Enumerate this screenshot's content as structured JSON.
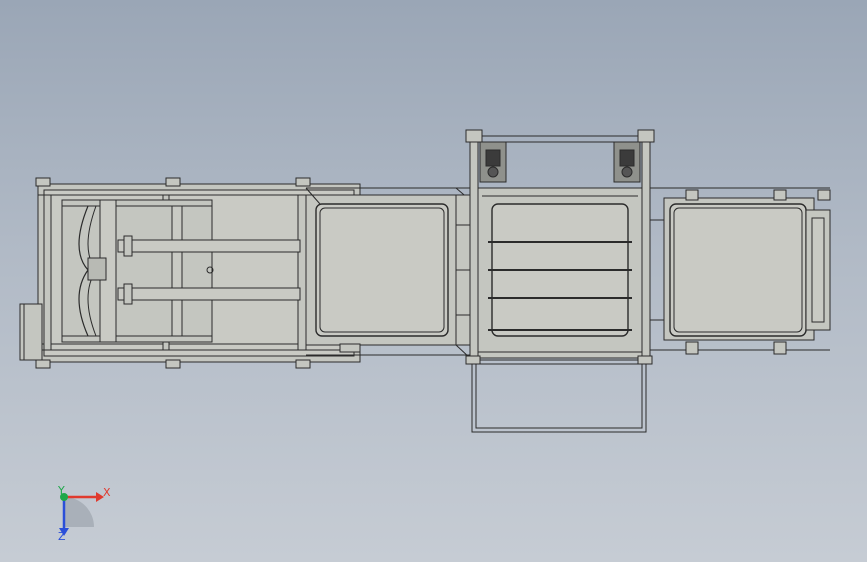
{
  "view": {
    "background_top": "#9aa6b6",
    "background_bottom": "#c6ccd4",
    "model_stroke": "#2b2b2b",
    "model_fill": "#c4c6c0",
    "panel_fill": "#c9cac4"
  },
  "triad": {
    "x_label": "X",
    "y_label": "Y",
    "z_label": "Z",
    "x_color": "#e03a2e",
    "y_color": "#1fa84a",
    "z_color": "#2b4fd9"
  }
}
